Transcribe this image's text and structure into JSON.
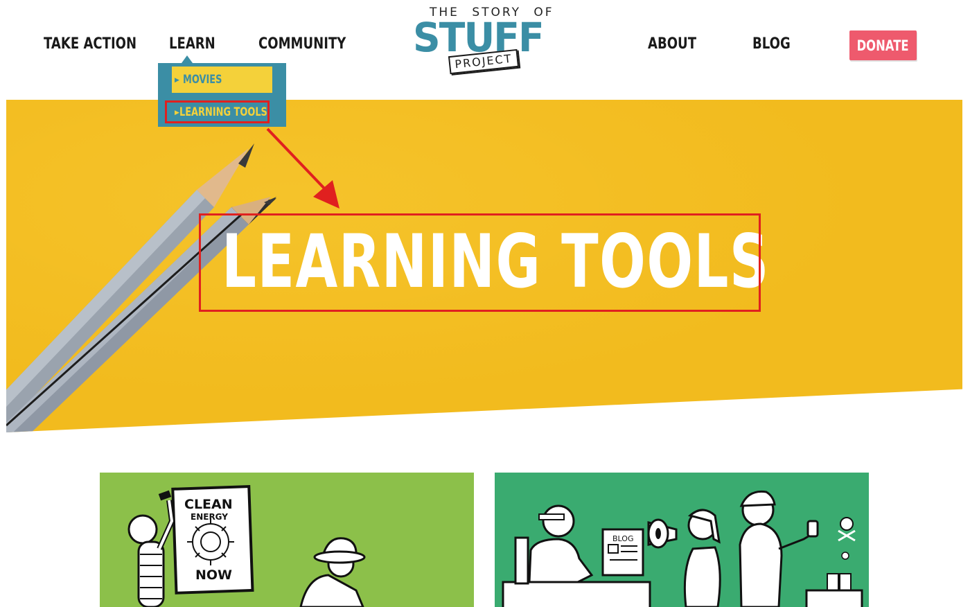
{
  "nav": {
    "left_items": [
      "TAKE ACTION",
      "LEARN",
      "COMMUNITY"
    ],
    "right_items": [
      "ABOUT",
      "BLOG"
    ],
    "donate": "DONATE"
  },
  "logo": {
    "top": "THE STORY OF",
    "main": "STUFF",
    "sub": "PROJECT"
  },
  "dropdown": {
    "items": [
      "MOVIES",
      "LEARNING TOOLS"
    ],
    "highlighted": "LEARNING TOOLS"
  },
  "hero": {
    "title": "LEARNING TOOLS"
  },
  "cards": [
    {
      "poster_line1": "CLEAN",
      "poster_line2": "ENERGY",
      "poster_line3": "NOW"
    },
    {
      "monitor_label": "BLOG"
    }
  ],
  "colors": {
    "brand_teal": "#3b8ea5",
    "donate": "#ee5a6d",
    "hero_yellow": "#f2bb1e",
    "highlight_red": "#e0201f",
    "card1_green": "#8cc04a",
    "card2_green": "#3aab70"
  }
}
